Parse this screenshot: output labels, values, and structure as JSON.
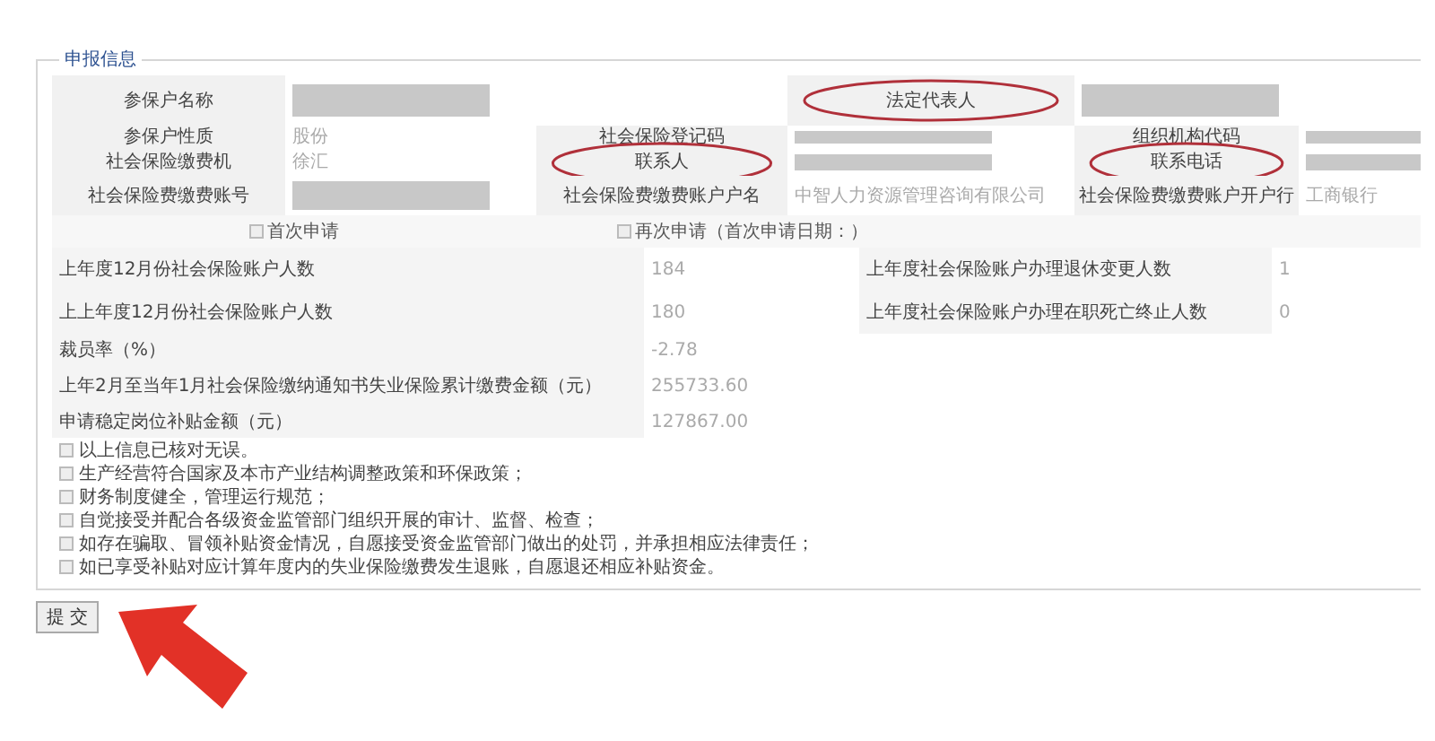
{
  "legend": "申报信息",
  "info_rows": [
    {
      "cells": [
        {
          "kind": "label",
          "text": "参保户名称"
        },
        {
          "kind": "redacted"
        },
        {
          "kind": "empty"
        },
        {
          "kind": "label",
          "text": "法定代表人",
          "circled": true
        },
        {
          "kind": "redacted"
        },
        {
          "kind": "empty"
        }
      ]
    },
    {
      "cells": [
        {
          "kind": "label",
          "text": "参保户性质"
        },
        {
          "kind": "value",
          "text": "股份"
        },
        {
          "kind": "label",
          "text": "社会保险登记码"
        },
        {
          "kind": "redacted"
        },
        {
          "kind": "label",
          "text": "组织机构代码"
        },
        {
          "kind": "redacted"
        }
      ]
    },
    {
      "cells": [
        {
          "kind": "label",
          "text": "社会保险缴费机"
        },
        {
          "kind": "value",
          "text": "徐汇"
        },
        {
          "kind": "label",
          "text": "联系人",
          "circled": true
        },
        {
          "kind": "redacted"
        },
        {
          "kind": "label",
          "text": "联系电话",
          "circled": true
        },
        {
          "kind": "redacted"
        }
      ]
    },
    {
      "cells": [
        {
          "kind": "label",
          "text": "社会保险费缴费账号"
        },
        {
          "kind": "redacted"
        },
        {
          "kind": "label",
          "text": "社会保险费缴费账户户名"
        },
        {
          "kind": "value",
          "text": "中智人力资源管理咨询有限公司"
        },
        {
          "kind": "label",
          "text": "社会保险费缴费账户开户行"
        },
        {
          "kind": "value",
          "text": "工商银行"
        }
      ]
    }
  ],
  "apply_options": [
    {
      "label": "首次申请",
      "checked": false
    },
    {
      "label": "再次申请（首次申请日期：）",
      "checked": false
    }
  ],
  "stats_rows": [
    {
      "pairs": [
        {
          "label": "上年度12月份社会保险账户人数",
          "value": "184"
        },
        {
          "label": "上年度社会保险账户办理退休变更人数",
          "value": "1"
        }
      ]
    },
    {
      "pairs": [
        {
          "label": "上上年度12月份社会保险账户人数",
          "value": "180"
        },
        {
          "label": "上年度社会保险账户办理在职死亡终止人数",
          "value": "0"
        }
      ]
    },
    {
      "pairs": [
        {
          "label": "裁员率（%）",
          "value": "-2.78"
        }
      ]
    },
    {
      "pairs": [
        {
          "label": "上年2月至当年1月社会保险缴纳通知书失业保险累计缴费金额（元）",
          "value": "255733.60"
        }
      ]
    },
    {
      "pairs": [
        {
          "label": "申请稳定岗位补贴金额（元）",
          "value": "127867.00"
        }
      ]
    }
  ],
  "declarations": [
    {
      "text": "以上信息已核对无误。",
      "checked": false
    },
    {
      "text": "生产经营符合国家及本市产业结构调整政策和环保政策；",
      "checked": false
    },
    {
      "text": "财务制度健全，管理运行规范；",
      "checked": false
    },
    {
      "text": "自觉接受并配合各级资金监管部门组织开展的审计、监督、检查；",
      "checked": false
    },
    {
      "text": "如存在骗取、冒领补贴资金情况，自愿接受资金监管部门做出的处罚，并承担相应法律责任；",
      "checked": false
    },
    {
      "text": "如已享受补贴对应计算年度内的失业保险缴费发生退账，自愿退还相应补贴资金。",
      "checked": false
    }
  ],
  "submit": "提 交"
}
